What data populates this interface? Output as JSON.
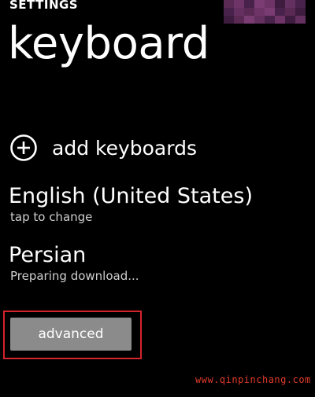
{
  "header": {
    "label": "SETTINGS",
    "title": "keyboard"
  },
  "add_keyboards": {
    "label": "add keyboards",
    "icon": "plus-circle-icon"
  },
  "keyboards": [
    {
      "name": "English (United States)",
      "subtitle": "tap to change"
    },
    {
      "name": "Persian",
      "subtitle": "Preparing download..."
    }
  ],
  "advanced_button": {
    "label": "advanced"
  },
  "watermark": {
    "text": "www.qinpinchang.com"
  },
  "colors": {
    "background": "#000000",
    "text": "#ffffff",
    "subtext": "#cfcfcf",
    "button": "#8b8b8b",
    "highlight": "#d3242b",
    "watermark": "#e03a2a",
    "pixel_block": [
      "#5a2a55",
      "#6e3468",
      "#48224a",
      "#7a3c73",
      "#3e1c3f",
      "#643060"
    ]
  }
}
